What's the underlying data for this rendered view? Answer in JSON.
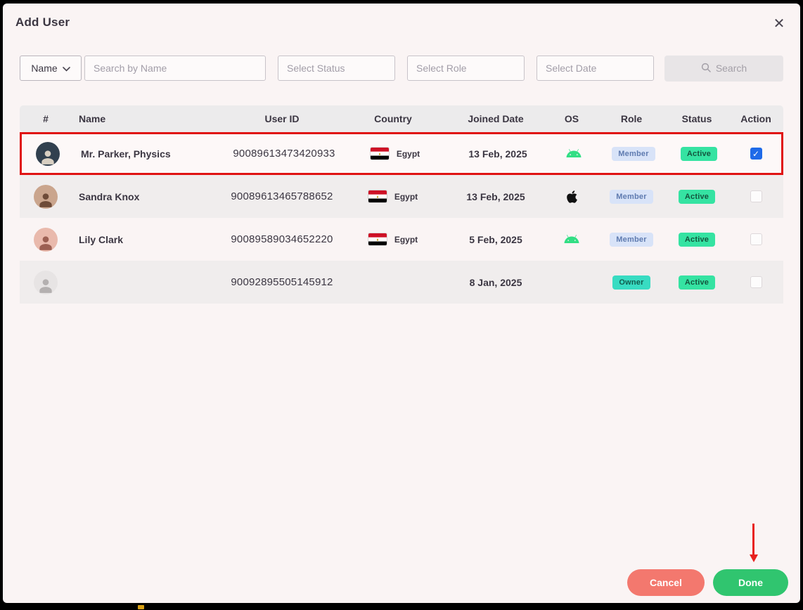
{
  "window": {
    "title": "Add User",
    "close_icon": "✕"
  },
  "filters": {
    "field_selector": {
      "label": "Name"
    },
    "search": {
      "placeholder": "Search by Name"
    },
    "status": {
      "placeholder": "Select Status"
    },
    "role": {
      "placeholder": "Select Role"
    },
    "date": {
      "placeholder": "Select Date"
    },
    "search_button": {
      "label": "Search"
    }
  },
  "table": {
    "headers": [
      "#",
      "Name",
      "User ID",
      "Country",
      "Joined Date",
      "OS",
      "Role",
      "Status",
      "Action"
    ],
    "rows": [
      {
        "name": "Mr. Parker, Physics",
        "user_id": "90089613473420933",
        "country": "Egypt",
        "joined_date": "13 Feb, 2025",
        "os": "android",
        "role": "Member",
        "status": "Active",
        "selected": true,
        "highlighted": true
      },
      {
        "name": "Sandra Knox",
        "user_id": "90089613465788652",
        "country": "Egypt",
        "joined_date": "13 Feb, 2025",
        "os": "apple",
        "role": "Member",
        "status": "Active",
        "selected": false,
        "highlighted": false
      },
      {
        "name": "Lily Clark",
        "user_id": "90089589034652220",
        "country": "Egypt",
        "joined_date": "5 Feb, 2025",
        "os": "android",
        "role": "Member",
        "status": "Active",
        "selected": false,
        "highlighted": false
      },
      {
        "name": "",
        "user_id": "90092895505145912",
        "country": "",
        "joined_date": "8 Jan, 2025",
        "os": "",
        "role": "Owner",
        "status": "Active",
        "selected": false,
        "highlighted": false
      }
    ]
  },
  "footer": {
    "cancel_label": "Cancel",
    "done_label": "Done"
  },
  "annotations": {
    "row_highlight_color": "#e01313",
    "arrow_color": "#e8221f"
  },
  "colors": {
    "modal_bg": "#faf4f4",
    "header_bg": "#ecebec",
    "member_badge": "#d8e3f8",
    "active_badge": "#35e3a2",
    "owner_badge": "#38dcc2",
    "checkbox_checked": "#1f6ae8",
    "cancel_button": "#f3786e",
    "done_button": "#30c56f",
    "android_green": "#32de84"
  }
}
